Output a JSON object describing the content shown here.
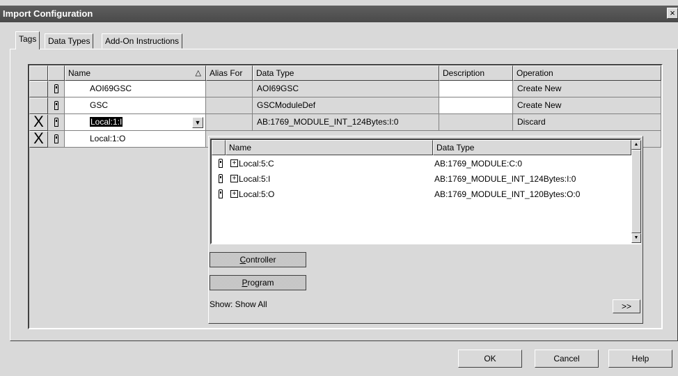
{
  "window": {
    "title": "Import Configuration",
    "close_label": "×"
  },
  "tabs": [
    {
      "label": "Tags",
      "active": true
    },
    {
      "label": "Data Types",
      "active": false
    },
    {
      "label": "Add-On Instructions",
      "active": false
    }
  ],
  "grid": {
    "columns": [
      "Name",
      "Alias For",
      "Data Type",
      "Description",
      "Operation"
    ],
    "sort_indicator": "△",
    "rows": [
      {
        "marker": "",
        "name": "AOI69GSC",
        "alias_for": "",
        "data_type": "AOI69GSC",
        "description": "",
        "operation": "Create New"
      },
      {
        "marker": "",
        "name": "GSC",
        "alias_for": "",
        "data_type": "GSCModuleDef",
        "description": "",
        "operation": "Create New"
      },
      {
        "marker": "X",
        "name": "Local:1:I",
        "alias_for": "",
        "data_type": "AB:1769_MODULE_INT_124Bytes:I:0",
        "description": "",
        "operation": "Discard"
      },
      {
        "marker": "X",
        "name": "Local:1:O",
        "alias_for": "",
        "data_type": "",
        "description": "",
        "operation": ""
      }
    ]
  },
  "tag_browser": {
    "columns": [
      "Name",
      "Data Type"
    ],
    "items": [
      {
        "name": "Local:5:C",
        "data_type": "AB:1769_MODULE:C:0"
      },
      {
        "name": "Local:5:I",
        "data_type": "AB:1769_MODULE_INT_124Bytes:I:0"
      },
      {
        "name": "Local:5:O",
        "data_type": "AB:1769_MODULE_INT_120Bytes:O:0"
      }
    ],
    "controller_button": {
      "mnemonic": "C",
      "rest": "ontroller"
    },
    "program_button": {
      "mnemonic": "P",
      "rest": "rogram"
    },
    "show_label": "Show: Show All",
    "more_button": ">>"
  },
  "footer": {
    "ok": "OK",
    "cancel": "Cancel",
    "help": "Help"
  }
}
